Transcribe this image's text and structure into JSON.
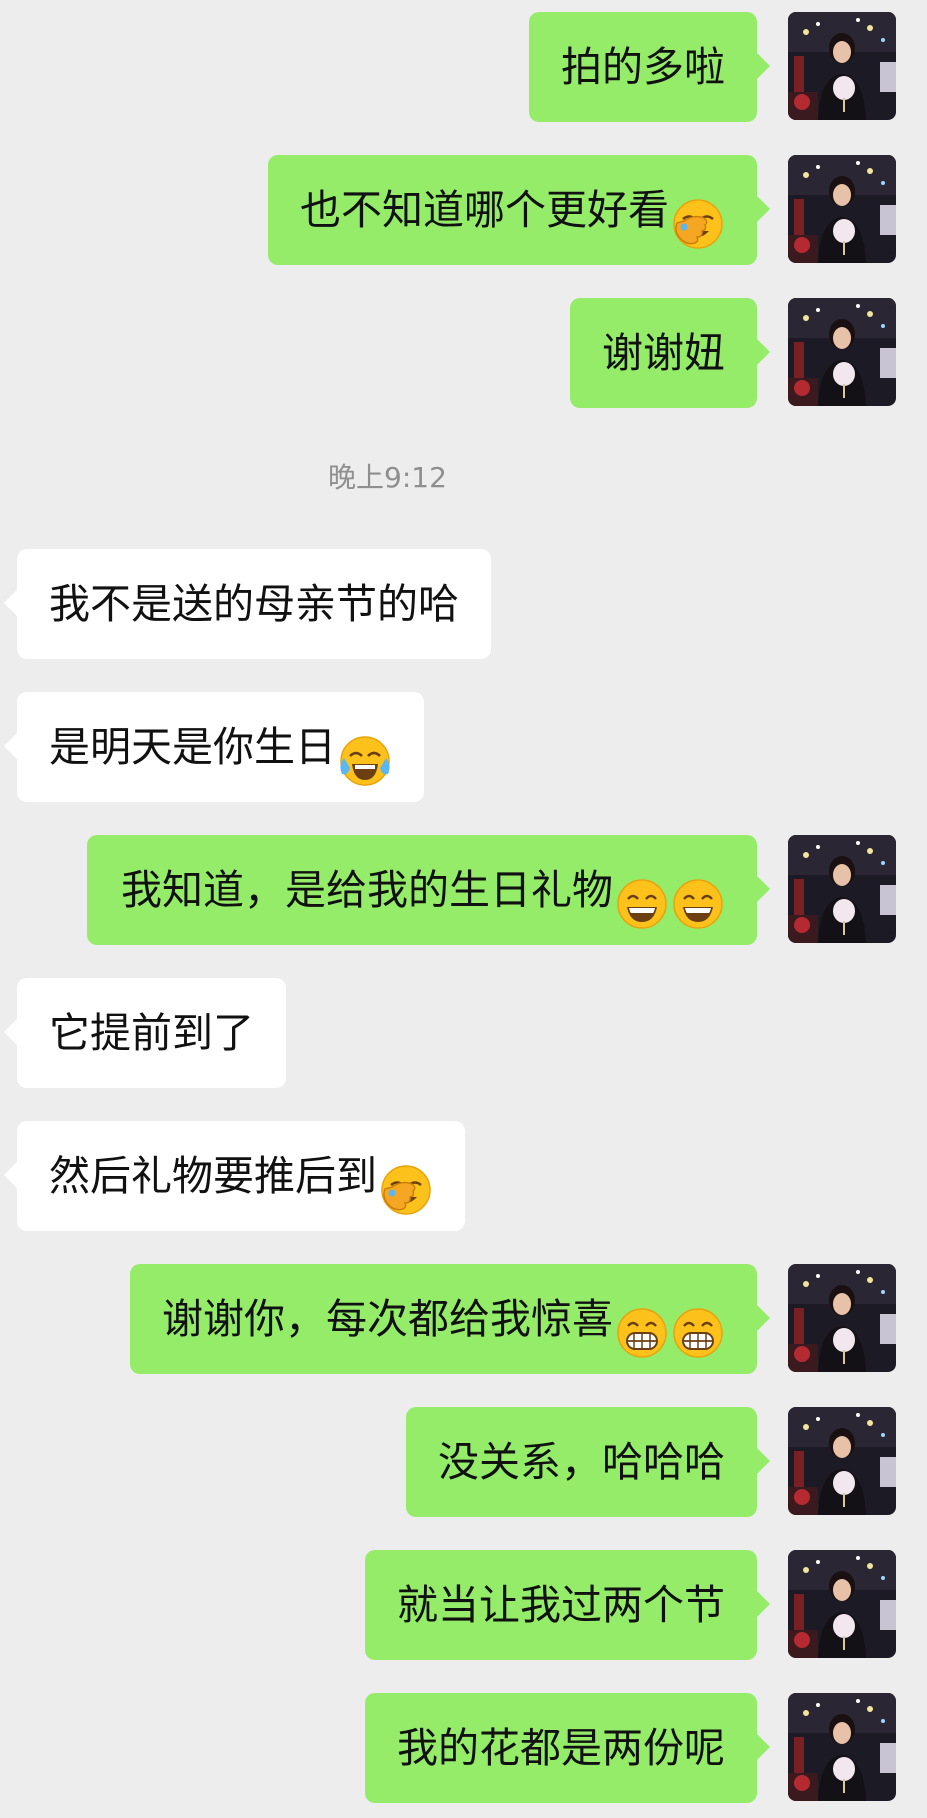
{
  "timestamp": "晚上9:12",
  "colors": {
    "background": "#ededed",
    "outgoing_bubble": "#95ec69",
    "incoming_bubble": "#ffffff",
    "text": "#111111",
    "timestamp": "#8f8f8f"
  },
  "messages": [
    {
      "dir": "out",
      "text": "拍的多啦",
      "emojis": []
    },
    {
      "dir": "out",
      "text": "也不知道哪个更好看",
      "emojis": [
        "facepalm-emoji"
      ]
    },
    {
      "dir": "out",
      "text": "谢谢妞",
      "emojis": []
    },
    {
      "dir": "in",
      "text": "我不是送的母亲节的哈",
      "emojis": []
    },
    {
      "dir": "in",
      "text": "是明天是你生日",
      "emojis": [
        "tears-of-joy-emoji"
      ]
    },
    {
      "dir": "out",
      "text": "我知道，是给我的生日礼物",
      "emojis": [
        "grinning-smile-emoji",
        "grinning-smile-emoji"
      ]
    },
    {
      "dir": "in",
      "text": "它提前到了",
      "emojis": []
    },
    {
      "dir": "in",
      "text": "然后礼物要推后到",
      "emojis": [
        "facepalm-emoji"
      ]
    },
    {
      "dir": "out",
      "text": "谢谢你，每次都给我惊喜",
      "emojis": [
        "beaming-grin-emoji",
        "beaming-grin-emoji"
      ]
    },
    {
      "dir": "out",
      "text": "没关系，哈哈哈",
      "emojis": []
    },
    {
      "dir": "out",
      "text": "就当让我过两个节",
      "emojis": []
    },
    {
      "dir": "out",
      "text": "我的花都是两份呢",
      "emojis": []
    }
  ]
}
